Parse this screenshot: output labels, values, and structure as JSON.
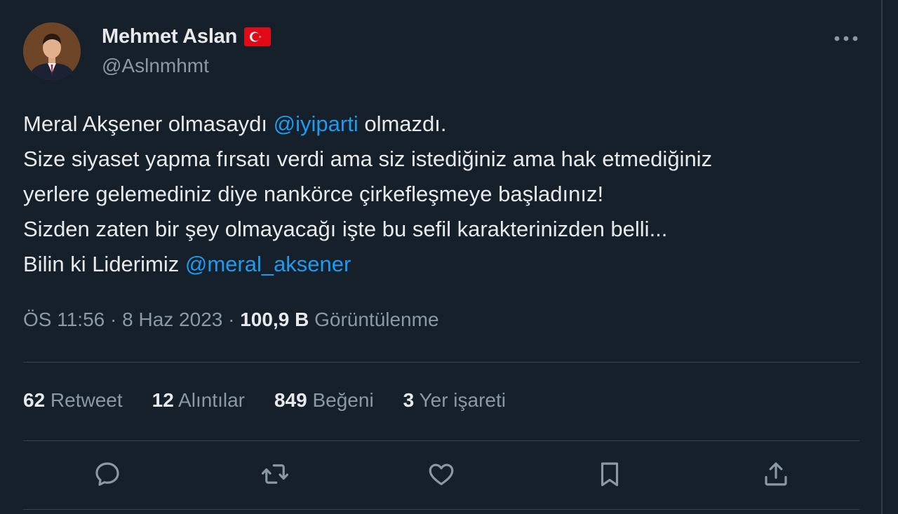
{
  "author": {
    "display_name": "Mehmet Aslan",
    "handle": "@Aslnmhmt",
    "flag_icon": "turkey-flag-icon"
  },
  "tweet": {
    "line1_pre": "Meral Akşener olmasaydı ",
    "line1_mention": "@iyiparti",
    "line1_post": " olmazdı.",
    "line2": "Size siyaset yapma fırsatı verdi ama siz istediğiniz ama hak etmediğiniz",
    "line3": "yerlere gelemediniz diye nankörce çirkefleşmeye başladınız!",
    "line4": "Sizden zaten bir şey olmayacağı işte bu sefil karakterinizden belli...",
    "line5_pre": "Bilin ki Liderimiz ",
    "line5_mention": "@meral_aksener"
  },
  "meta": {
    "time": "ÖS 11:56",
    "separator": " · ",
    "date": "8 Haz 2023",
    "views_count": "100,9 B",
    "views_label": " Görüntülenme"
  },
  "stats": {
    "retweets_count": "62",
    "retweets_label": " Retweet",
    "quotes_count": "12",
    "quotes_label": " Alıntılar",
    "likes_count": "849",
    "likes_label": " Beğeni",
    "bookmarks_count": "3",
    "bookmarks_label": " Yer işareti"
  },
  "colors": {
    "background": "#15202b",
    "text": "#e7e9ea",
    "muted": "#8b98a5",
    "accent": "#1d9bf0",
    "divider": "#38444d",
    "flag_red": "#e30a17"
  },
  "icons": {
    "more": "more-dots-icon",
    "reply": "reply-bubble-icon",
    "retweet": "retweet-icon",
    "like": "heart-icon",
    "bookmark": "bookmark-icon",
    "share": "share-icon"
  }
}
